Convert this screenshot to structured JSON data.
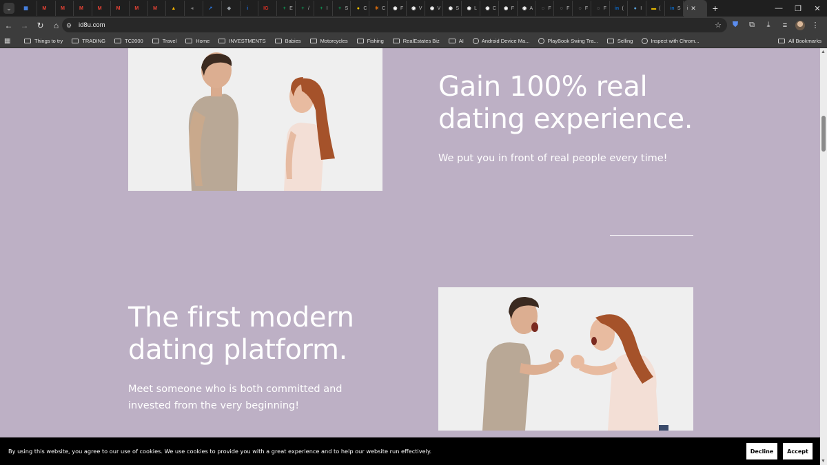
{
  "browser": {
    "tabs": [
      {
        "icon": "gmail-icon-grid",
        "color": "#4a8af4",
        "glyph": "▦"
      },
      {
        "icon": "gmail-icon",
        "color": "#ea4335",
        "glyph": "M"
      },
      {
        "icon": "gmail-icon",
        "color": "#ea4335",
        "glyph": "M"
      },
      {
        "icon": "gmail-icon",
        "color": "#ea4335",
        "glyph": "M"
      },
      {
        "icon": "gmail-icon",
        "color": "#ea4335",
        "glyph": "M"
      },
      {
        "icon": "gmail-icon",
        "color": "#ea4335",
        "glyph": "M"
      },
      {
        "icon": "gmail-icon",
        "color": "#ea4335",
        "glyph": "M"
      },
      {
        "icon": "gmail-icon",
        "color": "#ea4335",
        "glyph": "M"
      },
      {
        "icon": "drive-icon",
        "color": "#f4b400",
        "glyph": "▲"
      },
      {
        "icon": "audio-icon",
        "color": "#777777",
        "glyph": "◂"
      },
      {
        "icon": "chart-icon",
        "color": "#2a7ae2",
        "glyph": "↗"
      },
      {
        "icon": "shield-icon",
        "color": "#9aa0a6",
        "glyph": "◆"
      },
      {
        "icon": "info-icon",
        "color": "#1a73e8",
        "glyph": "i"
      },
      {
        "icon": "ig-icon",
        "color": "#d93025",
        "glyph": "IG"
      },
      {
        "icon": "sheets-icon",
        "color": "#0f9d58",
        "glyph": "+",
        "label": "E"
      },
      {
        "icon": "sheets-icon",
        "color": "#0f9d58",
        "glyph": "+",
        "label": "/"
      },
      {
        "icon": "sheets-round-icon",
        "color": "#0f9d58",
        "glyph": "+",
        "label": "I"
      },
      {
        "icon": "sheets-icon",
        "color": "#0f9d58",
        "glyph": "+",
        "label": "S"
      },
      {
        "icon": "circle-icon",
        "color": "#f9c300",
        "glyph": "●",
        "label": "C"
      },
      {
        "icon": "burst-icon",
        "color": "#e8710a",
        "glyph": "✳",
        "label": "C"
      },
      {
        "icon": "github-icon",
        "color": "#ffffff",
        "glyph": "◉",
        "label": "F"
      },
      {
        "icon": "github-icon",
        "color": "#ffffff",
        "glyph": "◉",
        "label": "V"
      },
      {
        "icon": "github-icon",
        "color": "#ffffff",
        "glyph": "◉",
        "label": "V"
      },
      {
        "icon": "github-icon",
        "color": "#ffffff",
        "glyph": "◉",
        "label": "S"
      },
      {
        "icon": "github-icon",
        "color": "#ffffff",
        "glyph": "◉",
        "label": "L"
      },
      {
        "icon": "github-icon",
        "color": "#ffffff",
        "glyph": "◉",
        "label": "C"
      },
      {
        "icon": "github-icon",
        "color": "#ffffff",
        "glyph": "◉",
        "label": "F"
      },
      {
        "icon": "github-icon",
        "color": "#ffffff",
        "glyph": "◉",
        "label": "A"
      },
      {
        "icon": "globe-icon",
        "color": "#cccccc",
        "glyph": "◌",
        "label": "F"
      },
      {
        "icon": "globe-icon",
        "color": "#cccccc",
        "glyph": "◌",
        "label": "F"
      },
      {
        "icon": "globe-icon",
        "color": "#cccccc",
        "glyph": "◌",
        "label": "F"
      },
      {
        "icon": "globe-icon",
        "color": "#cccccc",
        "glyph": "◌",
        "label": "F"
      },
      {
        "icon": "linkedin-icon",
        "color": "#0a66c2",
        "glyph": "in",
        "label": "("
      },
      {
        "icon": "earth-icon",
        "color": "#5aa0d8",
        "glyph": "●",
        "label": "I"
      },
      {
        "icon": "flag-icon",
        "color": "#e5b800",
        "glyph": "▬",
        "label": "("
      },
      {
        "icon": "linkedin-icon",
        "color": "#0a66c2",
        "glyph": "in",
        "label": "S"
      }
    ],
    "active_tab": {
      "label": "i",
      "close": "✕"
    },
    "new_tab": "+",
    "window_controls": [
      "—",
      "❐",
      "✕"
    ],
    "url": "id8u.com",
    "bookmarks": [
      {
        "type": "folder",
        "label": "Things to try"
      },
      {
        "type": "folder",
        "label": "TRADING"
      },
      {
        "type": "folder",
        "label": "TC2000"
      },
      {
        "type": "folder",
        "label": "Travel"
      },
      {
        "type": "folder",
        "label": "Home"
      },
      {
        "type": "folder",
        "label": "INVESTMENTS"
      },
      {
        "type": "folder",
        "label": "Babies"
      },
      {
        "type": "folder",
        "label": "Motorcycles"
      },
      {
        "type": "folder",
        "label": "Fishing"
      },
      {
        "type": "folder",
        "label": "RealEstates Biz"
      },
      {
        "type": "folder",
        "label": "AI"
      },
      {
        "type": "link",
        "label": "Android Device Ma..."
      },
      {
        "type": "link",
        "label": "PlayBook Swing Tra..."
      },
      {
        "type": "folder",
        "label": "Selling"
      },
      {
        "type": "link",
        "label": "Inspect with Chrom..."
      }
    ],
    "all_bookmarks": "All Bookmarks"
  },
  "content": {
    "section1": {
      "headline": "Gain 100% real dating experience.",
      "subtext": "We put you in front of real people every time!"
    },
    "section2": {
      "headline": "The first modern dating platform.",
      "subtext": "Meet someone who is both committed and invested from the very beginning!"
    }
  },
  "cookie_banner": {
    "text": "By using this website, you agree to our use of cookies. We use cookies to provide you with a great experience and to help our website run effectively.",
    "decline": "Decline",
    "accept": "Accept"
  },
  "colors": {
    "page_bg": "#bdb0c5",
    "headline": "#ffffff",
    "banner_bg": "#000000"
  }
}
